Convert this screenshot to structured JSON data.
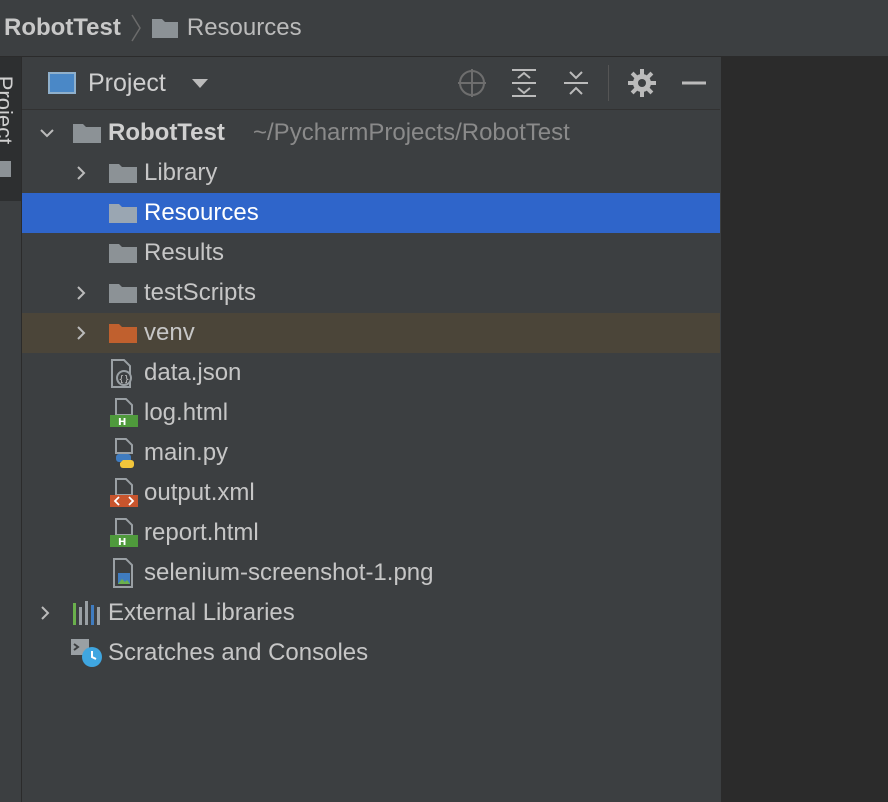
{
  "breadcrumb": {
    "root": "RobotTest",
    "child": "Resources"
  },
  "tool_strip": {
    "tab_label": "Project"
  },
  "panel": {
    "view_label": "Project",
    "buttons": [
      "locate-icon",
      "expand-all-icon",
      "collapse-all-icon",
      "gear-icon",
      "minimize-icon"
    ]
  },
  "tree": {
    "project_name": "RobotTest",
    "project_path": "~/PycharmProjects/RobotTest",
    "items": [
      {
        "label": "Library"
      },
      {
        "label": "Resources"
      },
      {
        "label": "Results"
      },
      {
        "label": "testScripts"
      },
      {
        "label": "venv"
      },
      {
        "label": "data.json"
      },
      {
        "label": "log.html"
      },
      {
        "label": "main.py"
      },
      {
        "label": "output.xml"
      },
      {
        "label": "report.html"
      },
      {
        "label": "selenium-screenshot-1.png"
      }
    ],
    "external_libraries": "External Libraries",
    "scratches": "Scratches and Consoles"
  },
  "colors": {
    "selection": "#2f65ca",
    "excluded_row": "#4b4539",
    "folder": "#8c9296",
    "excluded_folder": "#c0602e",
    "html_badge": "#4f9a3c",
    "xml_badge": "#c8552d"
  }
}
